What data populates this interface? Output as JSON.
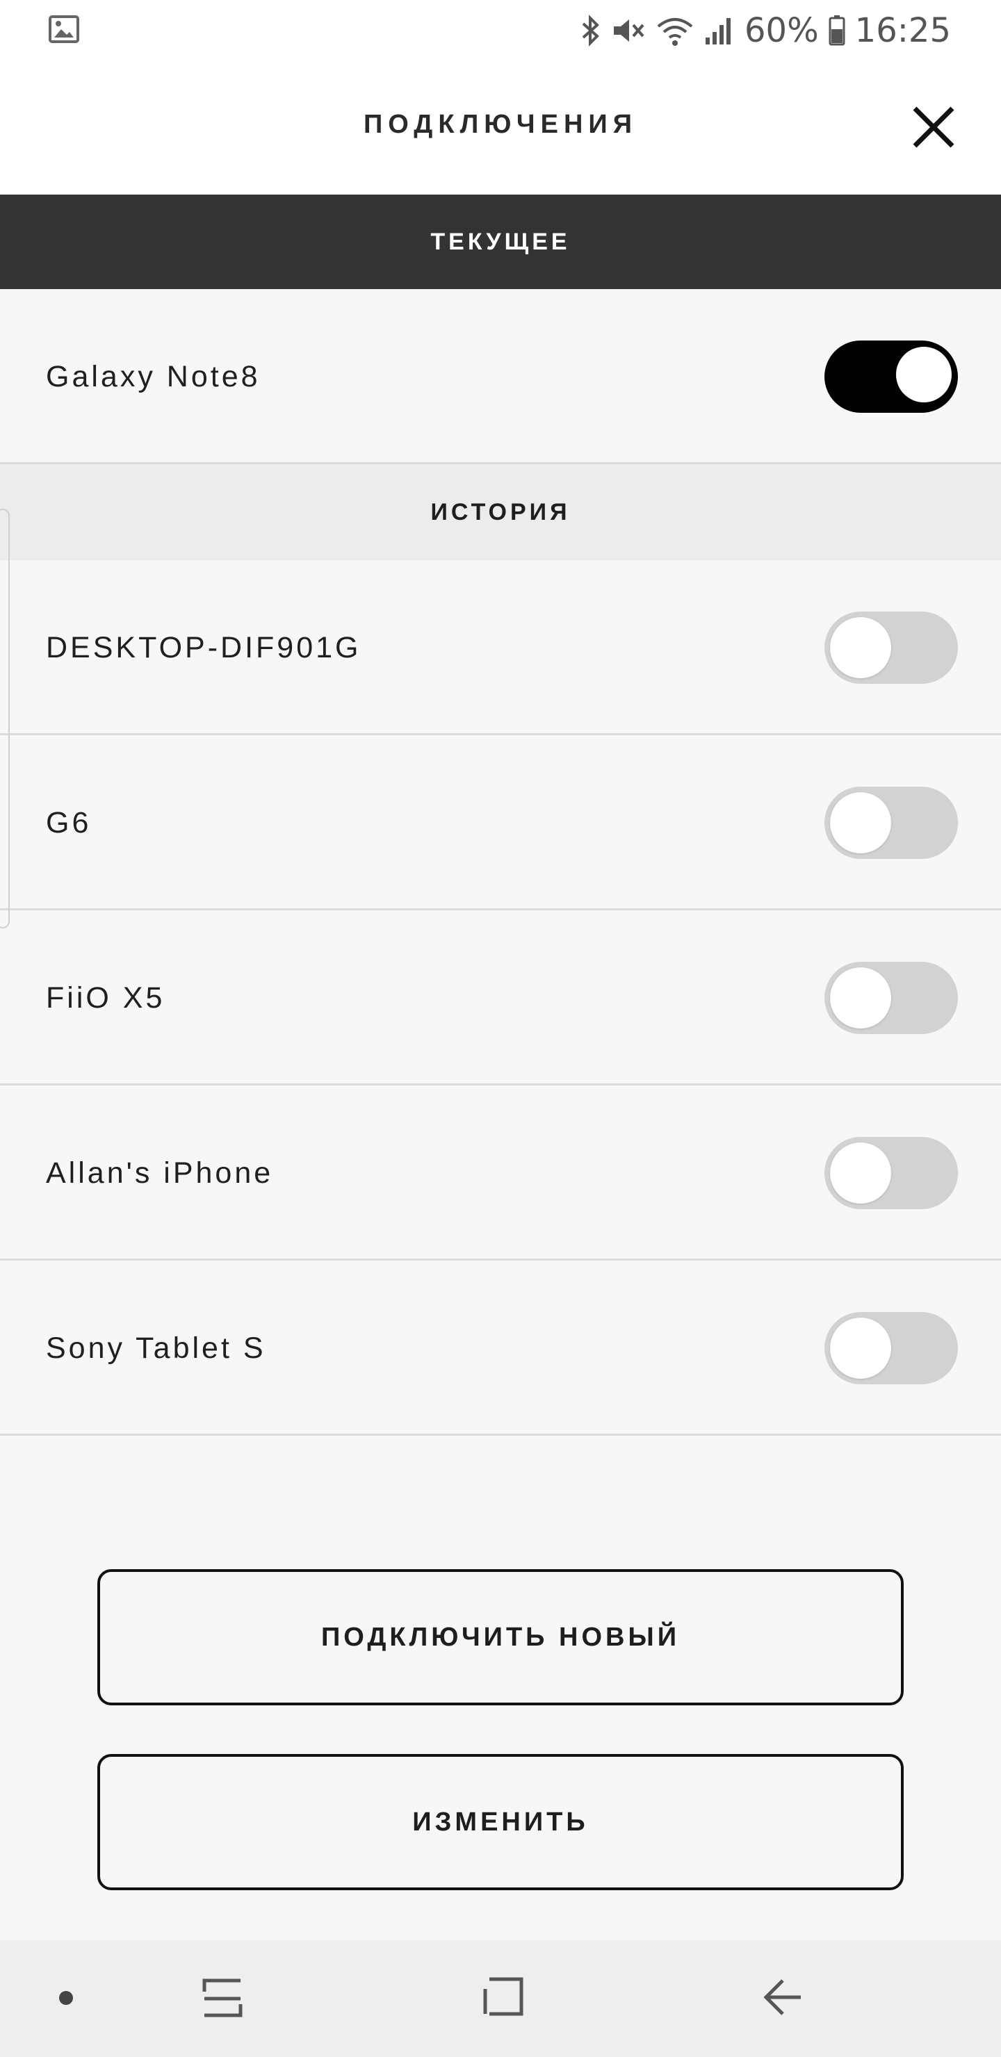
{
  "status_bar": {
    "battery": "60%",
    "time": "16:25",
    "icons": [
      "gallery-icon",
      "bluetooth-icon",
      "mute-icon",
      "wifi-icon",
      "signal-icon",
      "battery-icon"
    ]
  },
  "header": {
    "title": "ПОДКЛЮЧЕНИЯ",
    "close_icon": "close-icon"
  },
  "current": {
    "section_label": "ТЕКУЩЕЕ",
    "device": {
      "name": "Galaxy Note8",
      "connected": true
    }
  },
  "history": {
    "section_label": "ИСТОРИЯ",
    "devices": [
      {
        "name": "DESKTOP-DIF901G",
        "connected": false
      },
      {
        "name": "G6",
        "connected": false
      },
      {
        "name": "FiiO X5",
        "connected": false
      },
      {
        "name": "Allan's iPhone",
        "connected": false
      },
      {
        "name": "Sony Tablet S",
        "connected": false
      }
    ]
  },
  "actions": {
    "connect_new_label": "ПОДКЛЮЧИТЬ НОВЫЙ",
    "edit_label": "ИЗМЕНИТЬ"
  },
  "nav_bar": {
    "icons": [
      "dot-icon",
      "recents-icon",
      "home-icon",
      "back-icon"
    ]
  },
  "colors": {
    "section_dark": "#333333",
    "section_light": "#ececec",
    "toggle_on": "#000000",
    "toggle_off": "#d2d2d2",
    "background": "#f7f7f7"
  }
}
